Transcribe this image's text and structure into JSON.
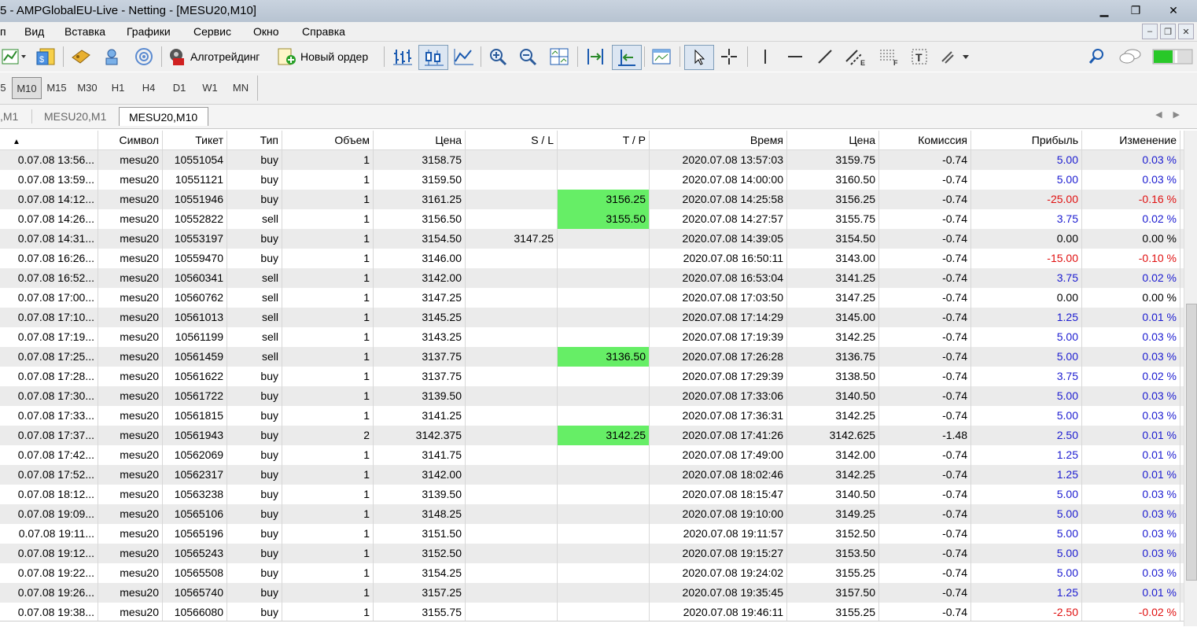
{
  "window": {
    "title": "5 - AMPGlobalEU-Live - Netting - [MESU20,M10]",
    "minimize": "▁",
    "maximize": "❐",
    "close": "✕"
  },
  "menu": [
    "п",
    "Вид",
    "Вставка",
    "Графики",
    "Сервис",
    "Окно",
    "Справка"
  ],
  "toolbar": {
    "algo_label": "Алготрейдинг",
    "new_order_label": "Новый ордер"
  },
  "timeframes": [
    "5",
    "M10",
    "M15",
    "M30",
    "H1",
    "H4",
    "D1",
    "W1",
    "MN"
  ],
  "selected_timeframe": "M10",
  "tabs": [
    ",M1",
    "MESU20,M1",
    "MESU20,M10"
  ],
  "active_tab": "MESU20,M10",
  "table": {
    "sort_indicator": "▲",
    "columns": [
      "",
      "Символ",
      "Тикет",
      "Тип",
      "Объем",
      "Цена",
      "S / L",
      "T / P",
      "Время",
      "Цена",
      "Комиссия",
      "Прибыль",
      "Изменение"
    ],
    "rows": [
      {
        "open": "0.07.08 13:56...",
        "symbol": "mesu20",
        "ticket": "10551054",
        "type": "buy",
        "volume": "1",
        "price": "3158.75",
        "sl": "",
        "tp": "",
        "time": "2020.07.08 13:57:03",
        "close_price": "3159.75",
        "commission": "-0.74",
        "profit": "5.00",
        "change": "0.03 %"
      },
      {
        "open": "0.07.08 13:59...",
        "symbol": "mesu20",
        "ticket": "10551121",
        "type": "buy",
        "volume": "1",
        "price": "3159.50",
        "sl": "",
        "tp": "",
        "time": "2020.07.08 14:00:00",
        "close_price": "3160.50",
        "commission": "-0.74",
        "profit": "5.00",
        "change": "0.03 %"
      },
      {
        "open": "0.07.08 14:12...",
        "symbol": "mesu20",
        "ticket": "10551946",
        "type": "buy",
        "volume": "1",
        "price": "3161.25",
        "sl": "",
        "tp": "3156.25",
        "time": "2020.07.08 14:25:58",
        "close_price": "3156.25",
        "commission": "-0.74",
        "profit": "-25.00",
        "change": "-0.16 %"
      },
      {
        "open": "0.07.08 14:26...",
        "symbol": "mesu20",
        "ticket": "10552822",
        "type": "sell",
        "volume": "1",
        "price": "3156.50",
        "sl": "",
        "tp": "3155.50",
        "time": "2020.07.08 14:27:57",
        "close_price": "3155.75",
        "commission": "-0.74",
        "profit": "3.75",
        "change": "0.02 %"
      },
      {
        "open": "0.07.08 14:31...",
        "symbol": "mesu20",
        "ticket": "10553197",
        "type": "buy",
        "volume": "1",
        "price": "3154.50",
        "sl": "3147.25",
        "tp": "",
        "time": "2020.07.08 14:39:05",
        "close_price": "3154.50",
        "commission": "-0.74",
        "profit": "0.00",
        "change": "0.00 %"
      },
      {
        "open": "0.07.08 16:26...",
        "symbol": "mesu20",
        "ticket": "10559470",
        "type": "buy",
        "volume": "1",
        "price": "3146.00",
        "sl": "",
        "tp": "",
        "time": "2020.07.08 16:50:11",
        "close_price": "3143.00",
        "commission": "-0.74",
        "profit": "-15.00",
        "change": "-0.10 %"
      },
      {
        "open": "0.07.08 16:52...",
        "symbol": "mesu20",
        "ticket": "10560341",
        "type": "sell",
        "volume": "1",
        "price": "3142.00",
        "sl": "",
        "tp": "",
        "time": "2020.07.08 16:53:04",
        "close_price": "3141.25",
        "commission": "-0.74",
        "profit": "3.75",
        "change": "0.02 %"
      },
      {
        "open": "0.07.08 17:00...",
        "symbol": "mesu20",
        "ticket": "10560762",
        "type": "sell",
        "volume": "1",
        "price": "3147.25",
        "sl": "",
        "tp": "",
        "time": "2020.07.08 17:03:50",
        "close_price": "3147.25",
        "commission": "-0.74",
        "profit": "0.00",
        "change": "0.00 %"
      },
      {
        "open": "0.07.08 17:10...",
        "symbol": "mesu20",
        "ticket": "10561013",
        "type": "sell",
        "volume": "1",
        "price": "3145.25",
        "sl": "",
        "tp": "",
        "time": "2020.07.08 17:14:29",
        "close_price": "3145.00",
        "commission": "-0.74",
        "profit": "1.25",
        "change": "0.01 %"
      },
      {
        "open": "0.07.08 17:19...",
        "symbol": "mesu20",
        "ticket": "10561199",
        "type": "sell",
        "volume": "1",
        "price": "3143.25",
        "sl": "",
        "tp": "",
        "time": "2020.07.08 17:19:39",
        "close_price": "3142.25",
        "commission": "-0.74",
        "profit": "5.00",
        "change": "0.03 %"
      },
      {
        "open": "0.07.08 17:25...",
        "symbol": "mesu20",
        "ticket": "10561459",
        "type": "sell",
        "volume": "1",
        "price": "3137.75",
        "sl": "",
        "tp": "3136.50",
        "time": "2020.07.08 17:26:28",
        "close_price": "3136.75",
        "commission": "-0.74",
        "profit": "5.00",
        "change": "0.03 %"
      },
      {
        "open": "0.07.08 17:28...",
        "symbol": "mesu20",
        "ticket": "10561622",
        "type": "buy",
        "volume": "1",
        "price": "3137.75",
        "sl": "",
        "tp": "",
        "time": "2020.07.08 17:29:39",
        "close_price": "3138.50",
        "commission": "-0.74",
        "profit": "3.75",
        "change": "0.02 %"
      },
      {
        "open": "0.07.08 17:30...",
        "symbol": "mesu20",
        "ticket": "10561722",
        "type": "buy",
        "volume": "1",
        "price": "3139.50",
        "sl": "",
        "tp": "",
        "time": "2020.07.08 17:33:06",
        "close_price": "3140.50",
        "commission": "-0.74",
        "profit": "5.00",
        "change": "0.03 %"
      },
      {
        "open": "0.07.08 17:33...",
        "symbol": "mesu20",
        "ticket": "10561815",
        "type": "buy",
        "volume": "1",
        "price": "3141.25",
        "sl": "",
        "tp": "",
        "time": "2020.07.08 17:36:31",
        "close_price": "3142.25",
        "commission": "-0.74",
        "profit": "5.00",
        "change": "0.03 %"
      },
      {
        "open": "0.07.08 17:37...",
        "symbol": "mesu20",
        "ticket": "10561943",
        "type": "buy",
        "volume": "2",
        "price": "3142.375",
        "sl": "",
        "tp": "3142.25",
        "time": "2020.07.08 17:41:26",
        "close_price": "3142.625",
        "commission": "-1.48",
        "profit": "2.50",
        "change": "0.01 %"
      },
      {
        "open": "0.07.08 17:42...",
        "symbol": "mesu20",
        "ticket": "10562069",
        "type": "buy",
        "volume": "1",
        "price": "3141.75",
        "sl": "",
        "tp": "",
        "time": "2020.07.08 17:49:00",
        "close_price": "3142.00",
        "commission": "-0.74",
        "profit": "1.25",
        "change": "0.01 %"
      },
      {
        "open": "0.07.08 17:52...",
        "symbol": "mesu20",
        "ticket": "10562317",
        "type": "buy",
        "volume": "1",
        "price": "3142.00",
        "sl": "",
        "tp": "",
        "time": "2020.07.08 18:02:46",
        "close_price": "3142.25",
        "commission": "-0.74",
        "profit": "1.25",
        "change": "0.01 %"
      },
      {
        "open": "0.07.08 18:12...",
        "symbol": "mesu20",
        "ticket": "10563238",
        "type": "buy",
        "volume": "1",
        "price": "3139.50",
        "sl": "",
        "tp": "",
        "time": "2020.07.08 18:15:47",
        "close_price": "3140.50",
        "commission": "-0.74",
        "profit": "5.00",
        "change": "0.03 %"
      },
      {
        "open": "0.07.08 19:09...",
        "symbol": "mesu20",
        "ticket": "10565106",
        "type": "buy",
        "volume": "1",
        "price": "3148.25",
        "sl": "",
        "tp": "",
        "time": "2020.07.08 19:10:00",
        "close_price": "3149.25",
        "commission": "-0.74",
        "profit": "5.00",
        "change": "0.03 %"
      },
      {
        "open": "0.07.08 19:11...",
        "symbol": "mesu20",
        "ticket": "10565196",
        "type": "buy",
        "volume": "1",
        "price": "3151.50",
        "sl": "",
        "tp": "",
        "time": "2020.07.08 19:11:57",
        "close_price": "3152.50",
        "commission": "-0.74",
        "profit": "5.00",
        "change": "0.03 %"
      },
      {
        "open": "0.07.08 19:12...",
        "symbol": "mesu20",
        "ticket": "10565243",
        "type": "buy",
        "volume": "1",
        "price": "3152.50",
        "sl": "",
        "tp": "",
        "time": "2020.07.08 19:15:27",
        "close_price": "3153.50",
        "commission": "-0.74",
        "profit": "5.00",
        "change": "0.03 %"
      },
      {
        "open": "0.07.08 19:22...",
        "symbol": "mesu20",
        "ticket": "10565508",
        "type": "buy",
        "volume": "1",
        "price": "3154.25",
        "sl": "",
        "tp": "",
        "time": "2020.07.08 19:24:02",
        "close_price": "3155.25",
        "commission": "-0.74",
        "profit": "5.00",
        "change": "0.03 %"
      },
      {
        "open": "0.07.08 19:26...",
        "symbol": "mesu20",
        "ticket": "10565740",
        "type": "buy",
        "volume": "1",
        "price": "3157.25",
        "sl": "",
        "tp": "",
        "time": "2020.07.08 19:35:45",
        "close_price": "3157.50",
        "commission": "-0.74",
        "profit": "1.25",
        "change": "0.01 %"
      },
      {
        "open": "0.07.08 19:38...",
        "symbol": "mesu20",
        "ticket": "10566080",
        "type": "buy",
        "volume": "1",
        "price": "3155.75",
        "sl": "",
        "tp": "",
        "time": "2020.07.08 19:46:11",
        "close_price": "3155.25",
        "commission": "-0.74",
        "profit": "-2.50",
        "change": "-0.02 %"
      }
    ]
  },
  "colors": {
    "tp_highlight": "#66ee66",
    "positive": "#1b1bd0",
    "negative": "#e01010",
    "row_alt": "#ebebeb"
  }
}
